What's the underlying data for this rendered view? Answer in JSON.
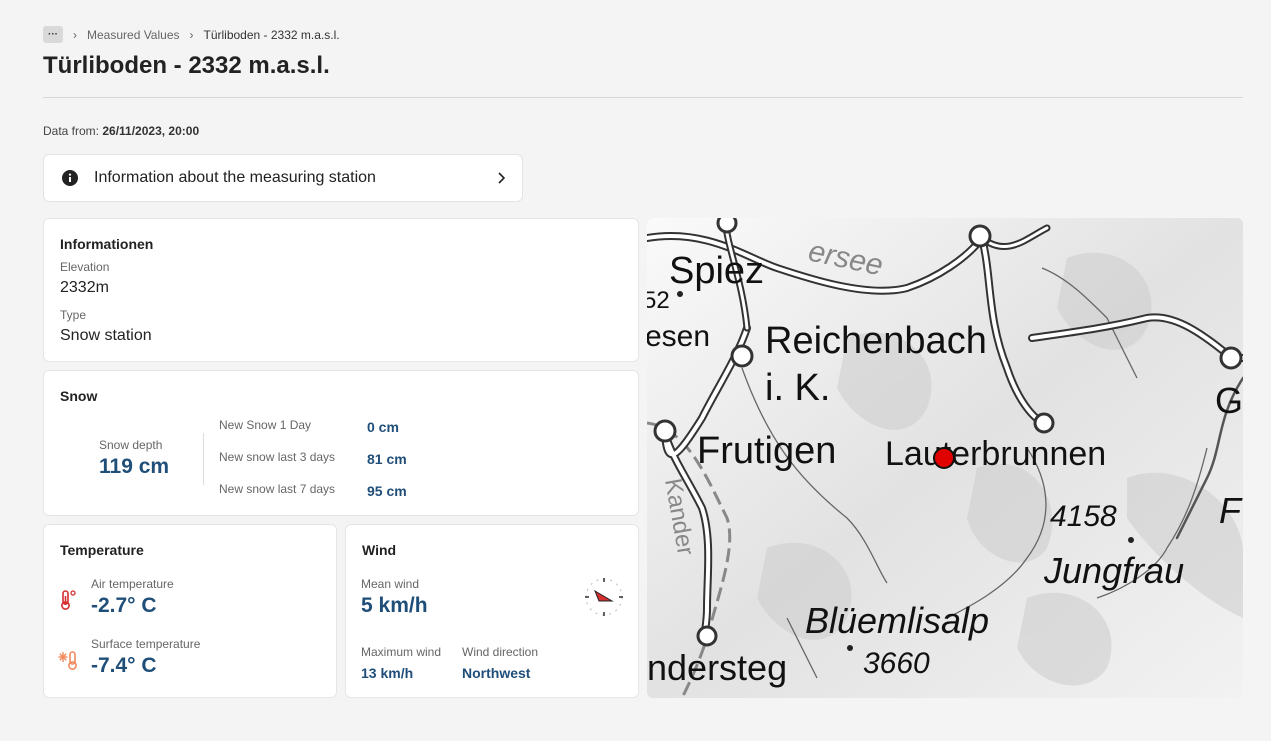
{
  "breadcrumb": {
    "more": "···",
    "items": [
      "Measured Values",
      "Türliboden - 2332 m.a.s.l."
    ]
  },
  "page": {
    "title": "Türliboden - 2332 m.a.s.l."
  },
  "data_from": {
    "label": "Data from:",
    "value": "26/11/2023, 20:00"
  },
  "info_link": {
    "label": "Information about the measuring station"
  },
  "informationen": {
    "title": "Informationen",
    "elevation_label": "Elevation",
    "elevation_value": "2332m",
    "type_label": "Type",
    "type_value": "Snow station"
  },
  "snow": {
    "title": "Snow",
    "depth_label": "Snow depth",
    "depth_value": "119 cm",
    "rows": [
      {
        "label": "New Snow 1 Day",
        "value": "0 cm"
      },
      {
        "label": "New snow last 3 days",
        "value": "81 cm"
      },
      {
        "label": "New snow last 7 days",
        "value": "95 cm"
      }
    ]
  },
  "temperature": {
    "title": "Temperature",
    "air_label": "Air temperature",
    "air_value": "-2.7° C",
    "surface_label": "Surface temperature",
    "surface_value": "-7.4° C"
  },
  "wind": {
    "title": "Wind",
    "mean_label": "Mean wind",
    "mean_value": "5 km/h",
    "max_label": "Maximum wind",
    "max_value": "13 km/h",
    "dir_label": "Wind direction",
    "dir_value": "Northwest"
  },
  "map": {
    "labels": {
      "spiez": "Spiez",
      "reichenbach": "Reichenbach",
      "ik": "i. K.",
      "frutigen": "Frutigen",
      "lauterbrunnen": "Lauterbrunnen",
      "jungfrau": "Jungfrau",
      "bluemlisalp": "Blüemlisalp",
      "kandersteg": "ndersteg",
      "esen": "esen",
      "kander": "Kander",
      "see": "ersee",
      "g": "G",
      "f": "F",
      "num52": "52",
      "h4158": "4158",
      "h3660": "3660"
    }
  },
  "colors": {
    "accent_blue": "#1f4e79",
    "temp_red": "#d32f2f",
    "temp_orange": "#f08a5d",
    "marker_red": "#e00000"
  },
  "icons": {
    "info": "info-circle-icon",
    "chevron": "chevron-right-icon",
    "air_temp": "thermometer-icon",
    "surface_temp": "snow-thermometer-icon",
    "wind_dir": "wind-compass-icon"
  }
}
